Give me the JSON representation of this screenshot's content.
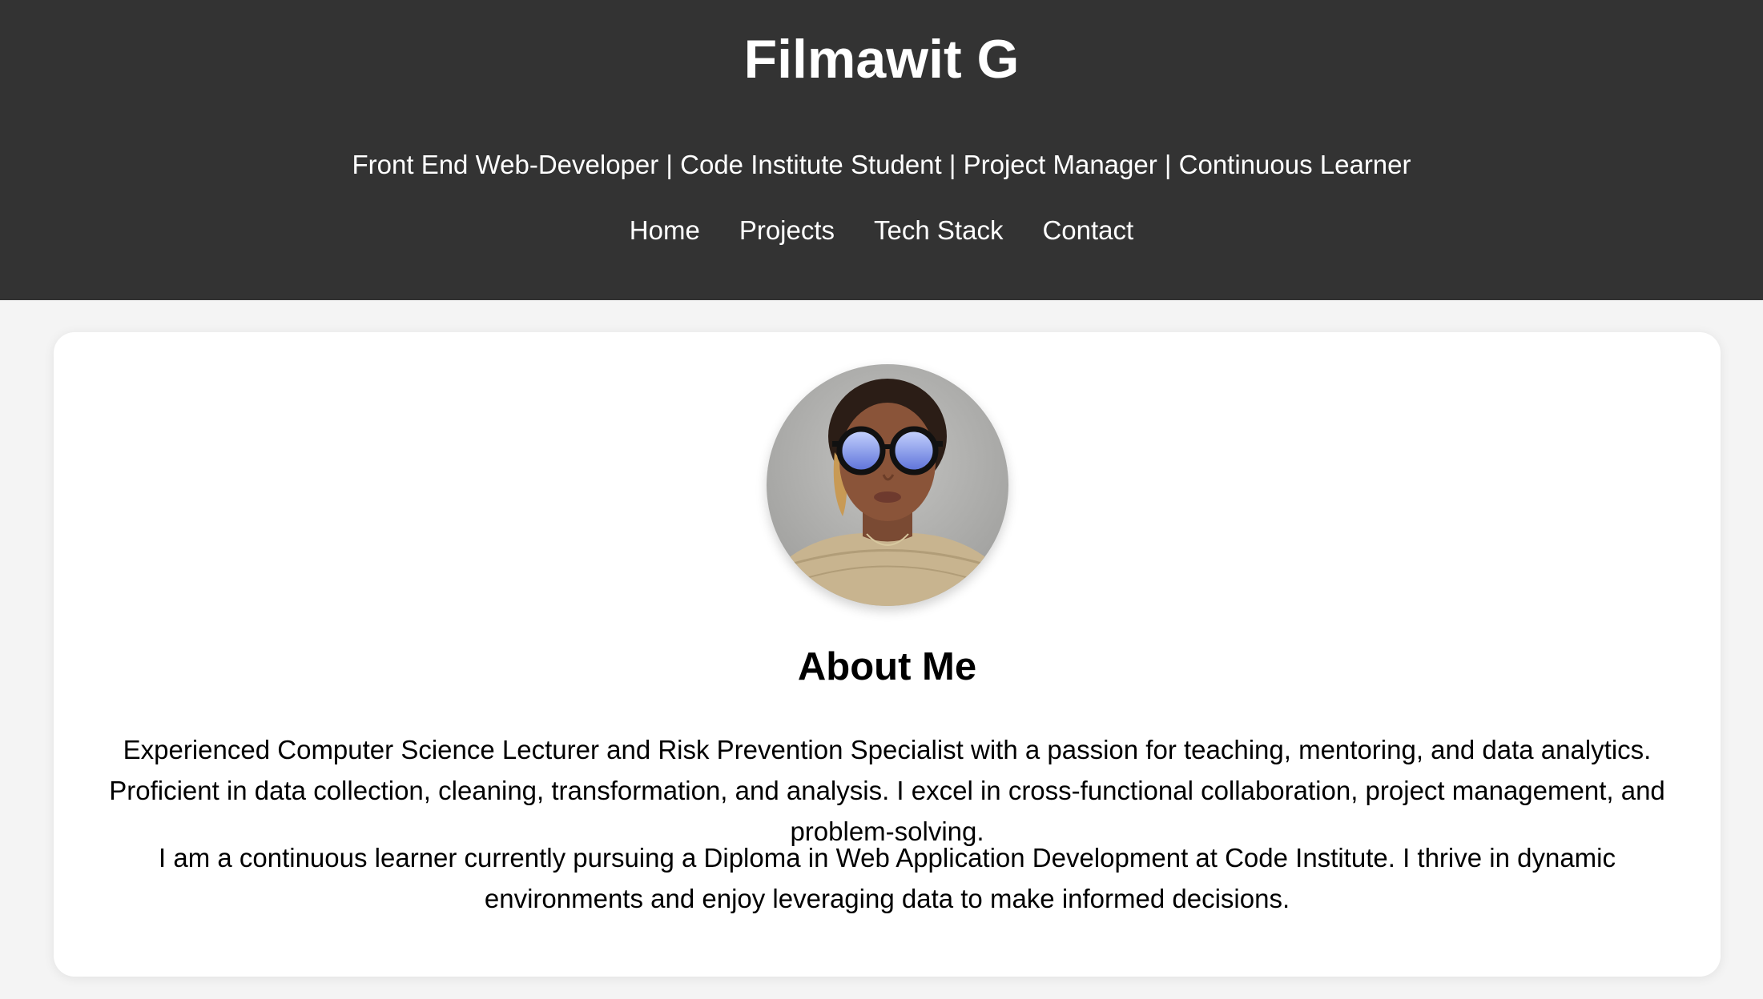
{
  "header": {
    "title": "Filmawit G",
    "tagline": "Front End Web-Developer | Code Institute Student | Project Manager | Continuous Learner",
    "nav": [
      {
        "label": "Home"
      },
      {
        "label": "Projects"
      },
      {
        "label": "Tech Stack"
      },
      {
        "label": "Contact"
      }
    ]
  },
  "about": {
    "heading": "About Me",
    "paragraphs": [
      "Experienced Computer Science Lecturer and Risk Prevention Specialist with a passion for teaching, mentoring, and data analytics. Proficient in data collection, cleaning, transformation, and analysis. I excel in cross-functional collaboration, project management, and problem-solving.",
      "I am a continuous learner currently pursuing a Diploma in Web Application Development at Code Institute. I thrive in dynamic environments and enjoy leveraging data to make informed decisions."
    ]
  },
  "colors": {
    "header_bg": "#333333",
    "page_bg": "#f4f4f4",
    "card_bg": "#ffffff",
    "header_text": "#ffffff"
  }
}
